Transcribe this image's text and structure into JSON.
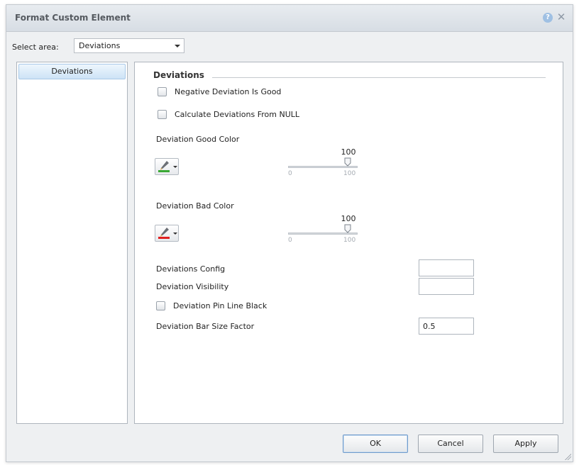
{
  "window": {
    "title": "Format Custom Element",
    "help_glyph": "?",
    "close_glyph": "✕"
  },
  "area_selector": {
    "label": "Select area:",
    "selected": "Deviations"
  },
  "sidebar": {
    "items": [
      {
        "label": "Deviations",
        "selected": true
      }
    ]
  },
  "section": {
    "title": "Deviations",
    "negative_deviation_is_good": {
      "label": "Negative Deviation Is Good",
      "checked": false
    },
    "calculate_from_null": {
      "label": "Calculate Deviations From NULL",
      "checked": false
    },
    "good_color": {
      "label": "Deviation Good Color",
      "swatch_color": "#3aa835",
      "icon": "paint-brush-icon",
      "opacity": {
        "value": "100",
        "min": "0",
        "max": "100"
      }
    },
    "bad_color": {
      "label": "Deviation Bad Color",
      "swatch_color": "#e02020",
      "icon": "paint-brush-icon",
      "opacity": {
        "value": "100",
        "min": "0",
        "max": "100"
      }
    },
    "deviations_config": {
      "label": "Deviations Config",
      "value": ""
    },
    "deviation_visibility": {
      "label": "Deviation Visibility",
      "value": ""
    },
    "pin_line_black": {
      "label": "Deviation Pin Line Black",
      "checked": false
    },
    "bar_size_factor": {
      "label": "Deviation Bar Size Factor",
      "value": "0.5"
    }
  },
  "buttons": {
    "ok": "OK",
    "cancel": "Cancel",
    "apply": "Apply"
  },
  "colors": {
    "selection_blue": "#cde3f6",
    "dialog_bg": "#eef0f2"
  }
}
